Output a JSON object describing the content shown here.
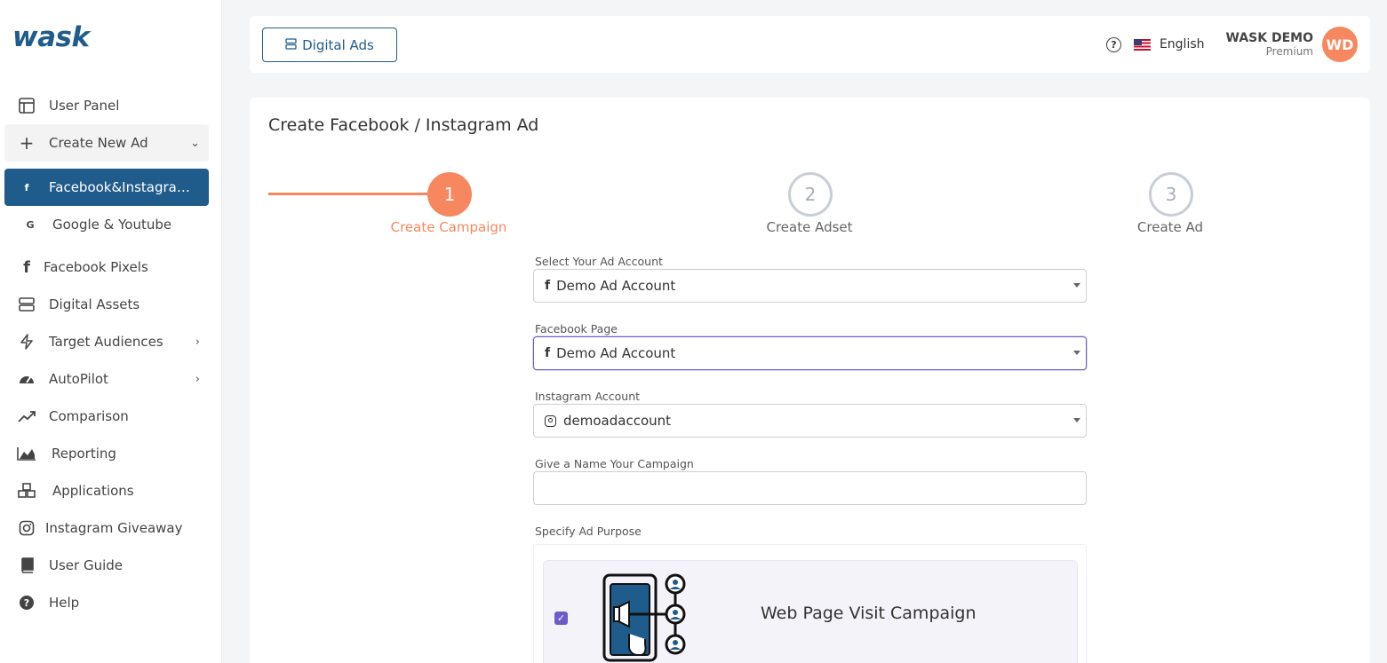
{
  "sidebar": {
    "logo": "wask",
    "items": [
      {
        "label": "User Panel",
        "icon": "layout-icon"
      },
      {
        "label": "Create New Ad",
        "icon": "plus-icon"
      },
      {
        "label": "Facebook&Instagram Ads",
        "icon": "facebook-icon"
      },
      {
        "label": "Google & Youtube",
        "icon": "google-icon"
      },
      {
        "label": "Facebook Pixels",
        "icon": "facebook-icon"
      },
      {
        "label": "Digital Assets",
        "icon": "server-icon"
      },
      {
        "label": "Target Audiences",
        "icon": "lightning-icon"
      },
      {
        "label": "AutoPilot",
        "icon": "gauge-icon"
      },
      {
        "label": "Comparison",
        "icon": "trending-up-icon"
      },
      {
        "label": "Reporting",
        "icon": "area-chart-icon"
      },
      {
        "label": "Applications",
        "icon": "cubes-icon"
      },
      {
        "label": "Instagram Giveaway",
        "icon": "instagram-icon"
      },
      {
        "label": "User Guide",
        "icon": "book-icon"
      },
      {
        "label": "Help",
        "icon": "question-circle-icon"
      }
    ]
  },
  "topbar": {
    "digital_ads_label": "Digital Ads",
    "language": "English",
    "user_name": "WASK DEMO",
    "user_plan": "Premium",
    "avatar_initials": "WD"
  },
  "main": {
    "title": "Create Facebook / Instagram Ad",
    "steps": [
      {
        "number": "1",
        "label": "Create Campaign",
        "state": "active"
      },
      {
        "number": "2",
        "label": "Create Adset",
        "state": "pending"
      },
      {
        "number": "3",
        "label": "Create Ad",
        "state": "pending"
      }
    ],
    "fields": {
      "ad_account_label": "Select Your Ad Account",
      "ad_account_value": "Demo Ad Account",
      "fb_page_label": "Facebook Page",
      "fb_page_value": "Demo Ad Account",
      "instagram_label": "Instagram Account",
      "instagram_value": "demoadaccount",
      "campaign_name_label": "Give a Name Your Campaign",
      "campaign_name_value": "",
      "purpose_label": "Specify Ad Purpose"
    },
    "purpose_option": {
      "title": "Web Page Visit Campaign",
      "checked": true
    }
  },
  "colors": {
    "brand": "#1f5c8b",
    "accent": "#f7875e",
    "focus": "#6e5ac9"
  }
}
